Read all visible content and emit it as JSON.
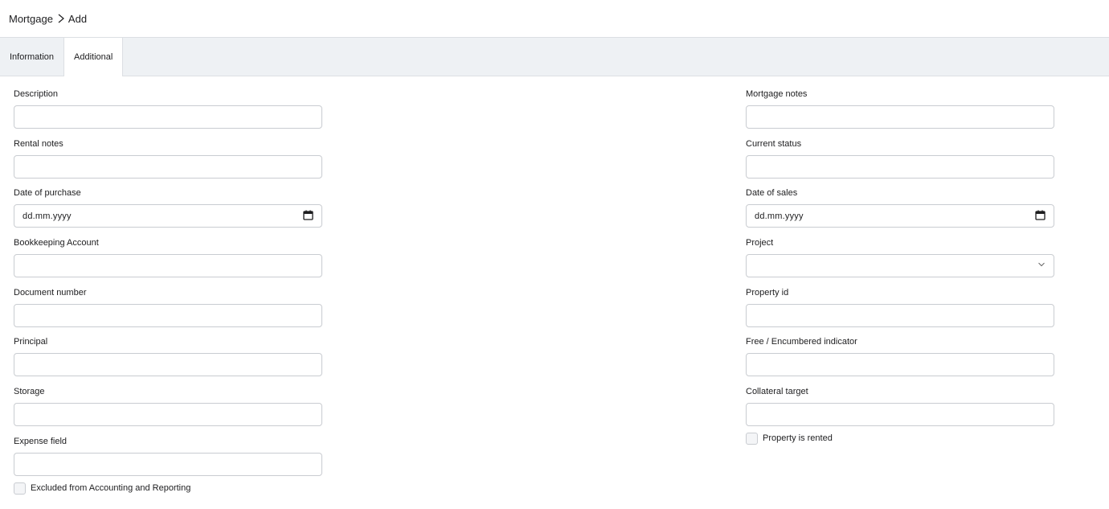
{
  "breadcrumb": {
    "parent": "Mortgage",
    "current": "Add"
  },
  "tabs": [
    {
      "label": "Information",
      "active": false
    },
    {
      "label": "Additional",
      "active": true
    }
  ],
  "left_fields": [
    {
      "label": "Description",
      "value": ""
    },
    {
      "label": "Rental notes",
      "value": ""
    },
    {
      "label": "Date of purchase",
      "placeholder": "dd.mm.yyyy",
      "type": "date"
    },
    {
      "label": "Bookkeeping Account",
      "value": ""
    },
    {
      "label": "Document number",
      "value": ""
    },
    {
      "label": "Principal",
      "value": ""
    },
    {
      "label": "Storage",
      "value": ""
    },
    {
      "label": "Expense field",
      "value": ""
    }
  ],
  "left_checkbox": {
    "label": "Excluded from Accounting and Reporting",
    "checked": false
  },
  "right_fields": [
    {
      "label": "Mortgage notes",
      "value": ""
    },
    {
      "label": "Current status",
      "value": ""
    },
    {
      "label": "Date of sales",
      "placeholder": "dd.mm.yyyy",
      "type": "date"
    },
    {
      "label": "Project",
      "value": "",
      "type": "select"
    },
    {
      "label": "Property id",
      "value": ""
    },
    {
      "label": "Free / Encumbered indicator",
      "value": ""
    },
    {
      "label": "Collateral target",
      "value": ""
    }
  ],
  "right_checkbox": {
    "label": "Property is rented",
    "checked": false
  },
  "icons": {
    "calendar": "calendar-icon",
    "chevron": "chevron-down-icon",
    "breadcrumb_sep": "chevron-right-icon"
  }
}
